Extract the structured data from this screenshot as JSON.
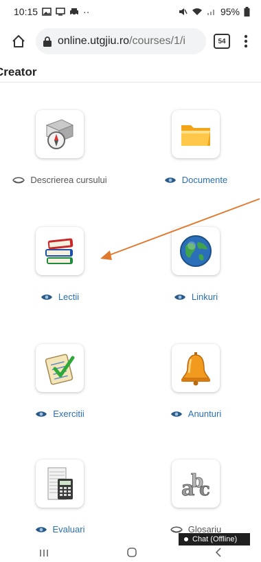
{
  "status_bar": {
    "time": "10:15",
    "notification_icons": [
      "image-icon",
      "cast-icon",
      "car-icon"
    ],
    "more": "··",
    "battery": "95%"
  },
  "browser": {
    "url_host": "online.utgjiu.ro",
    "url_path": "/courses/1/i",
    "tab_count": "54"
  },
  "page": {
    "title": "Creator"
  },
  "tools": [
    {
      "label": "Descrierea cursului",
      "icon": "course-description-icon",
      "visible": false
    },
    {
      "label": "Documente",
      "icon": "folder-icon",
      "visible": true
    },
    {
      "label": "Lectii",
      "icon": "books-icon",
      "visible": true
    },
    {
      "label": "Linkuri",
      "icon": "globe-icon",
      "visible": true
    },
    {
      "label": "Exercitii",
      "icon": "checklist-icon",
      "visible": true
    },
    {
      "label": "Anunturi",
      "icon": "bell-icon",
      "visible": true
    },
    {
      "label": "Evaluari",
      "icon": "calculator-icon",
      "visible": true
    },
    {
      "label": "Glosariu",
      "icon": "abc-icon",
      "visible": false
    }
  ],
  "chat": {
    "label": "Chat (Offline)"
  },
  "colors": {
    "link": "#2a6fb0",
    "annotation_arrow": "#e07a2e"
  }
}
